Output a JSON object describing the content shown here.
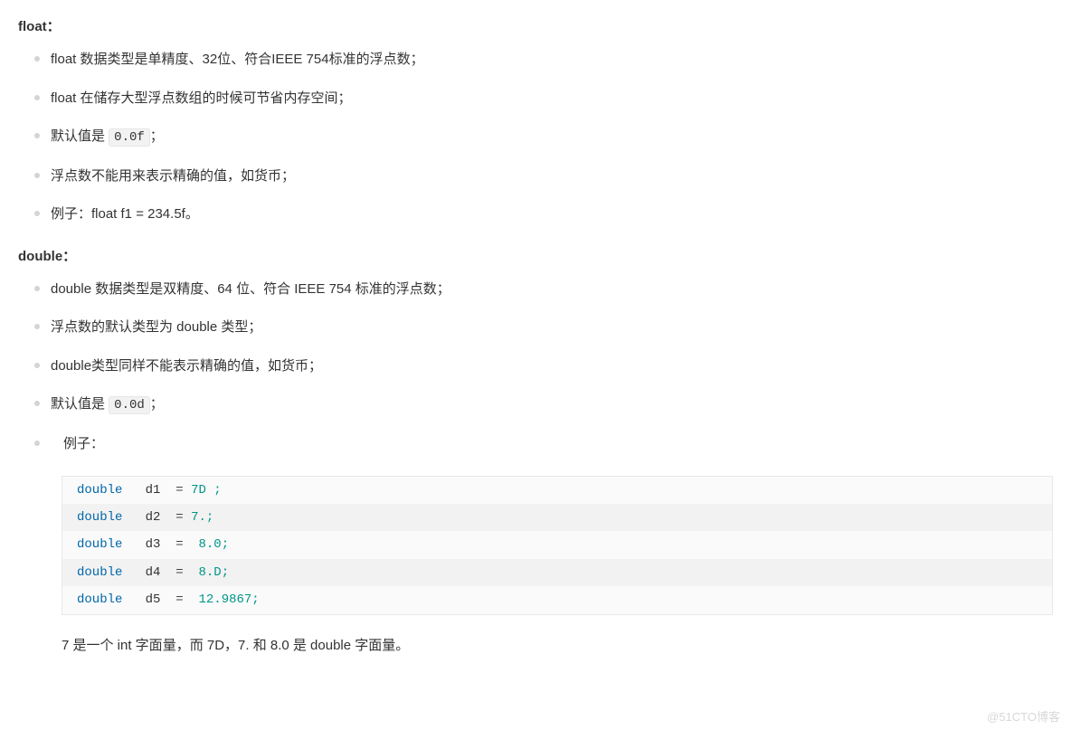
{
  "sections": [
    {
      "title": "float：",
      "items": [
        {
          "text": "float 数据类型是单精度、32位、符合IEEE 754标准的浮点数；"
        },
        {
          "text": "float 在储存大型浮点数组的时候可节省内存空间；"
        },
        {
          "prefix": "默认值是 ",
          "code": "0.0f",
          "suffix": "；"
        },
        {
          "text": "浮点数不能用来表示精确的值，如货币；"
        },
        {
          "text": "例子：float f1 = 234.5f。"
        }
      ]
    },
    {
      "title": "double：",
      "items": [
        {
          "text": "double 数据类型是双精度、64 位、符合 IEEE 754 标准的浮点数；"
        },
        {
          "text": "浮点数的默认类型为 double 类型；"
        },
        {
          "text": "double类型同样不能表示精确的值，如货币；"
        },
        {
          "prefix": "默认值是 ",
          "code": "0.0d",
          "suffix": "；"
        },
        {
          "nested": "例子："
        }
      ]
    }
  ],
  "code_block": [
    {
      "kw": "double",
      "var": "d1",
      "op": "=",
      "val": "7D ;"
    },
    {
      "kw": "double",
      "var": "d2",
      "op": "=",
      "val": "7.;"
    },
    {
      "kw": "double",
      "var": "d3",
      "op": "= ",
      "val": "8.0;"
    },
    {
      "kw": "double",
      "var": "d4",
      "op": "= ",
      "val": "8.D;"
    },
    {
      "kw": "double",
      "var": "d5",
      "op": "= ",
      "val": "12.9867;"
    }
  ],
  "footnote": "7 是一个 int 字面量，而 7D，7. 和 8.0 是 double 字面量。",
  "watermark": "@51CTO博客"
}
